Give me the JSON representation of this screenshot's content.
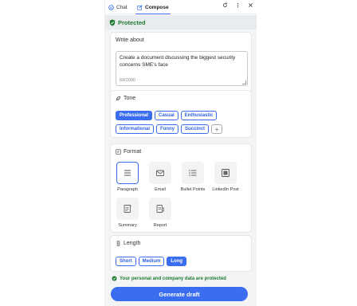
{
  "tabs": [
    {
      "label": "Chat",
      "icon": "chat-bubble-icon"
    },
    {
      "label": "Compose",
      "icon": "compose-edit-icon"
    }
  ],
  "header_icons": [
    "refresh-icon",
    "more-vertical-icon",
    "close-icon"
  ],
  "banner": {
    "label": "Protected",
    "icon": "shield-check-icon",
    "color": "#1e7a2e"
  },
  "write_about": {
    "title": "Write about",
    "value": "Create a document discussing the biggest security concerns SME's face",
    "counter": "69/2000"
  },
  "tone": {
    "title": "Tone",
    "icon": "tone-icon",
    "options": [
      "Professional",
      "Casual",
      "Enthusiastic",
      "Informational",
      "Funny",
      "Succinct"
    ],
    "selected": "Professional",
    "add_label": "+"
  },
  "format": {
    "title": "Format",
    "icon": "format-icon",
    "options": [
      {
        "label": "Paragraph",
        "icon": "paragraph-icon"
      },
      {
        "label": "Email",
        "icon": "email-icon"
      },
      {
        "label": "Bullet Points",
        "icon": "bullet-list-icon"
      },
      {
        "label": "LinkedIn Post",
        "icon": "linkedin-icon"
      },
      {
        "label": "Summary",
        "icon": "summary-icon"
      },
      {
        "label": "Report",
        "icon": "report-icon"
      }
    ],
    "selected": "Paragraph"
  },
  "length": {
    "title": "Length",
    "icon": "length-icon",
    "options": [
      "Short",
      "Medium",
      "Long"
    ],
    "selected": "Long"
  },
  "privacy_note": "Your personal and company data are protected",
  "generate_label": "Generate draft",
  "colors": {
    "accent": "#3a6df0",
    "protected_green": "#1e7a2e"
  }
}
